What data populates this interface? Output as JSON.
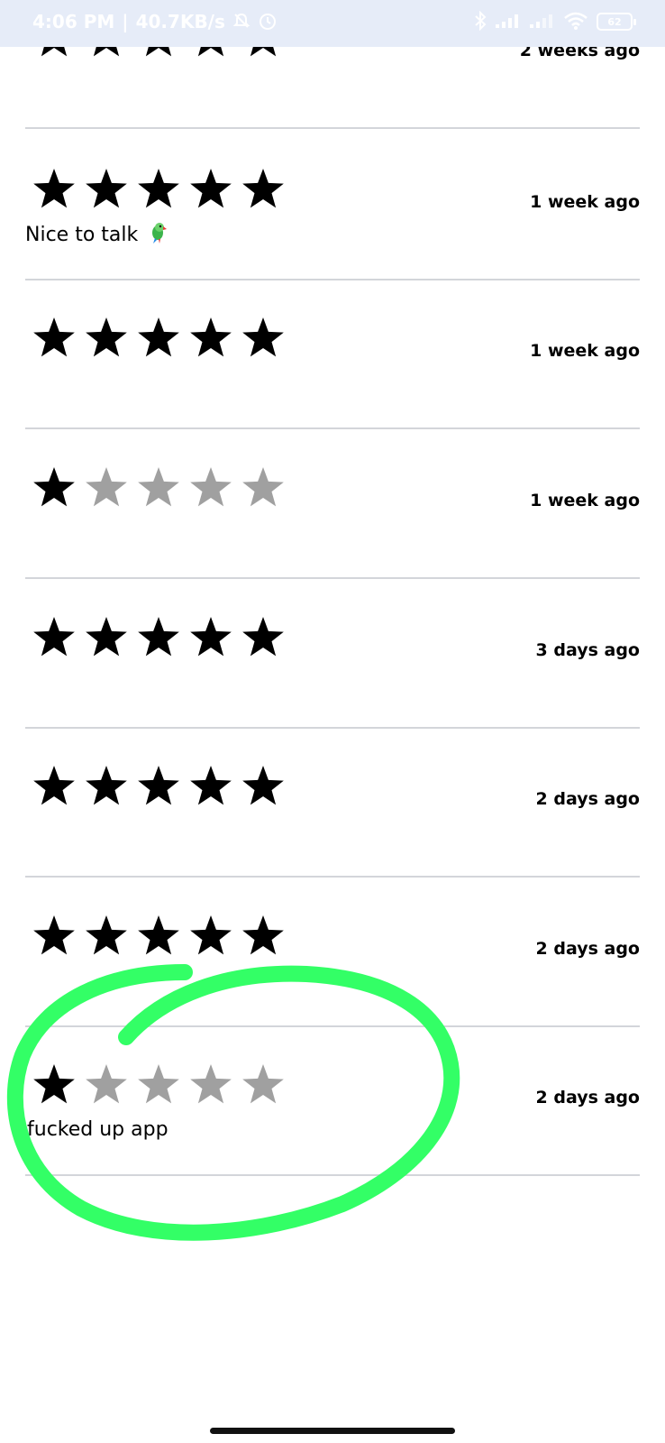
{
  "status_bar": {
    "time": "4:06 PM",
    "network_speed": "40.7KB/s",
    "battery": "62",
    "icons": [
      "mute-icon",
      "alarm-icon",
      "bluetooth-icon",
      "signal-icon",
      "signal-icon",
      "wifi-icon",
      "battery-icon"
    ]
  },
  "star_colors": {
    "filled": "#000000",
    "empty": "#a0a0a0"
  },
  "annotation_color": "#33ff66",
  "reviews": [
    {
      "rating": 5,
      "time": "2 weeks ago",
      "comment": ""
    },
    {
      "rating": 5,
      "time": "1 week ago",
      "comment": "Nice to talk",
      "emoji": "parrot-icon"
    },
    {
      "rating": 5,
      "time": "1 week ago",
      "comment": ""
    },
    {
      "rating": 1,
      "time": "1 week ago",
      "comment": ""
    },
    {
      "rating": 5,
      "time": "3 days ago",
      "comment": ""
    },
    {
      "rating": 5,
      "time": "2 days ago",
      "comment": ""
    },
    {
      "rating": 5,
      "time": "2 days ago",
      "comment": ""
    },
    {
      "rating": 1,
      "time": "2 days ago",
      "comment": "fucked up  app"
    }
  ]
}
